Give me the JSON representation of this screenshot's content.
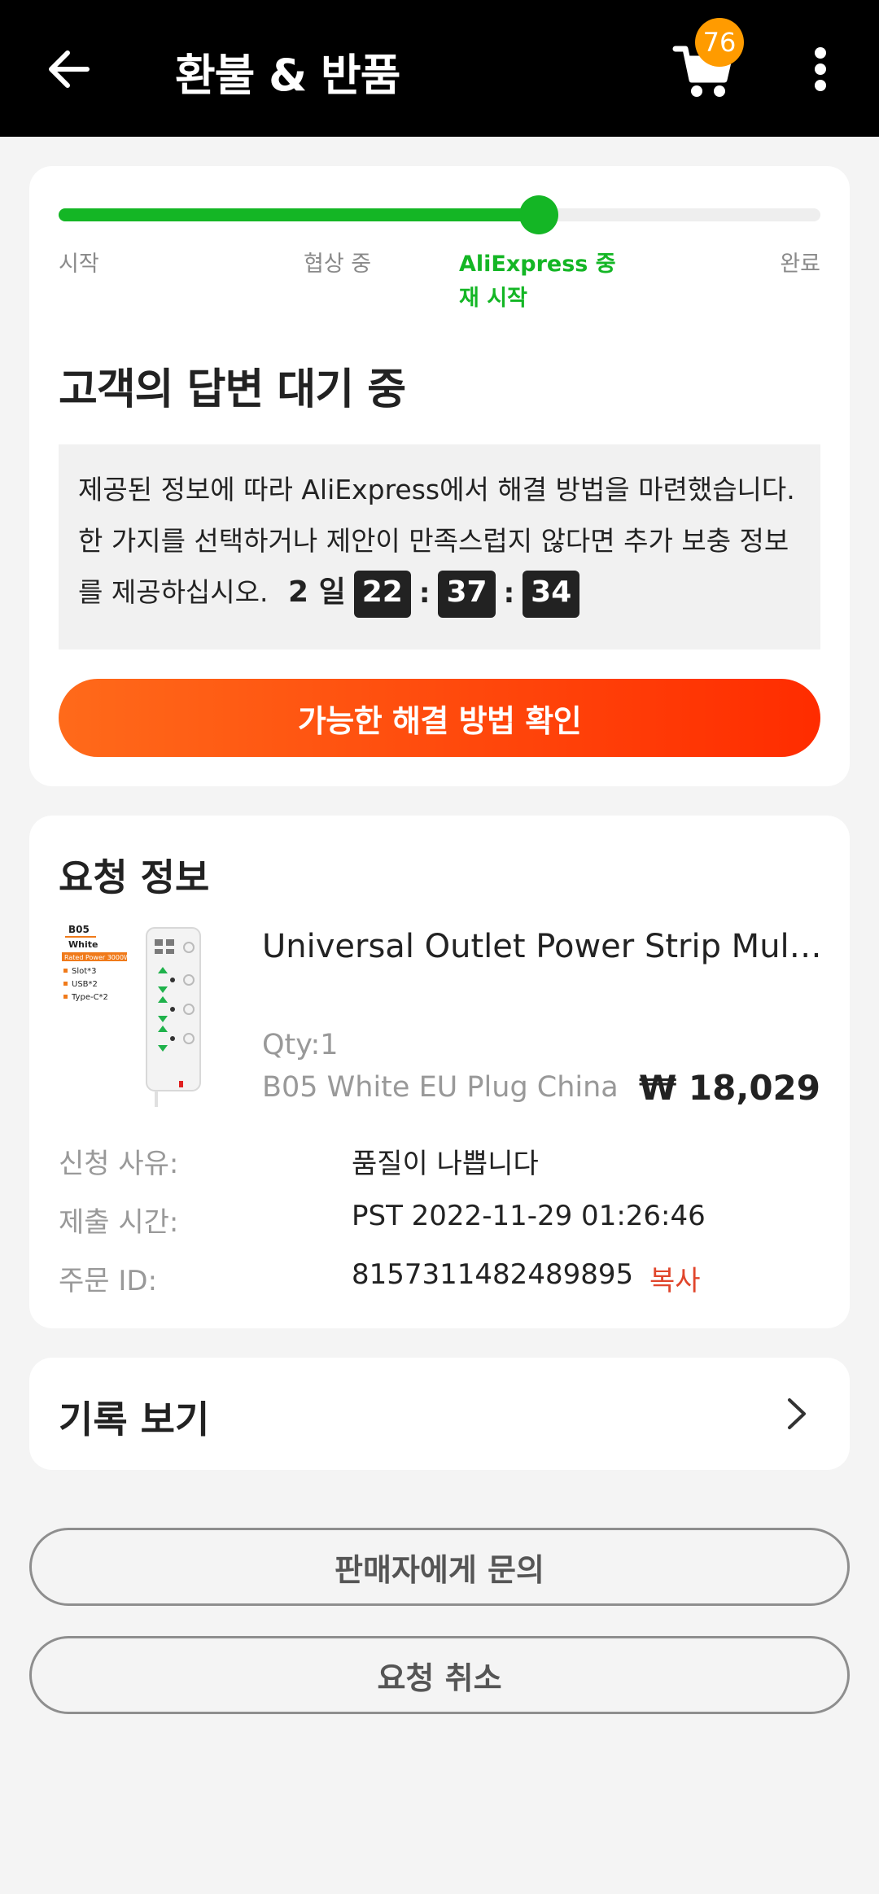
{
  "header": {
    "title": "환불 & 반품",
    "cart_count": "76",
    "icons": [
      "back-arrow-icon",
      "cart-icon",
      "more-vertical-icon"
    ],
    "background": "#000000"
  },
  "progress": {
    "current_fraction": 0.63,
    "steps": [
      {
        "label": "시작"
      },
      {
        "label": "협상 중"
      },
      {
        "label_line1": "AliExpress 중",
        "label_line2": "재 시작",
        "active": true
      },
      {
        "label": "완료"
      }
    ],
    "active_color": "#14b625"
  },
  "status": {
    "title": "고객의 답변 대기 중",
    "message": "제공된 정보에 따라 AliExpress에서 해결 방법을 마련했습니다. 한 가지를 선택하거나 제안이 만족스럽지 않다면 추가 보충 정보를 제공하십시오.",
    "timer": {
      "days": "2",
      "days_unit": "일",
      "hours": "22",
      "minutes": "37",
      "seconds": "34",
      "sep": ":"
    },
    "primary_button": "가능한 해결 방법 확인"
  },
  "request": {
    "section_title": "요청 정보",
    "product": {
      "name": "Universal Outlet Power Strip Mult...",
      "qty": "Qty:1",
      "variant": "B05 White EU Plug China",
      "price": "₩ 18,029",
      "thumb": {
        "model": "B05",
        "color": "White",
        "power": "Rated Power 3000W",
        "features": [
          "Slot*3",
          "USB*2",
          "Type-C*2"
        ]
      }
    },
    "rows": [
      {
        "label": "신청 사유:",
        "value": "품질이 나쁩니다"
      },
      {
        "label": "제출 시간:",
        "value": "PST 2022-11-29 01:26:46"
      },
      {
        "label": "주문 ID:",
        "value": "8157311482489895"
      }
    ],
    "copy_label": "복사",
    "copy_color": "#e0452b"
  },
  "history": {
    "label": "기록 보기"
  },
  "buttons": {
    "contact_seller": "판매자에게 문의",
    "cancel_request": "요청 취소"
  }
}
